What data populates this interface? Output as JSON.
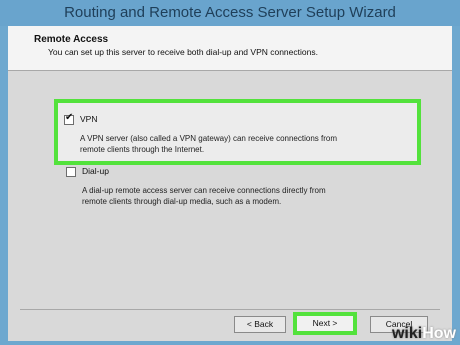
{
  "window": {
    "title": "Routing and Remote Access Server Setup Wizard"
  },
  "header": {
    "title": "Remote Access",
    "subtitle": "You can set up this server to receive both dial-up and VPN connections."
  },
  "options": {
    "vpn": {
      "label": "VPN",
      "checked": true,
      "desc1": "A VPN server (also called a VPN gateway) can receive connections from",
      "desc2": "remote clients through the Internet."
    },
    "dialup": {
      "label": "Dial-up",
      "checked": false,
      "desc1": "A dial-up remote access server can receive connections directly from",
      "desc2": "remote clients through dial-up media, such as a modem."
    }
  },
  "buttons": {
    "back": "< Back",
    "next": "Next >",
    "cancel": "Cancel"
  },
  "watermark": {
    "part1": "wiki",
    "part2": "How"
  },
  "colors": {
    "highlight": "#53e23c",
    "title_bar": "#69a4cd"
  }
}
